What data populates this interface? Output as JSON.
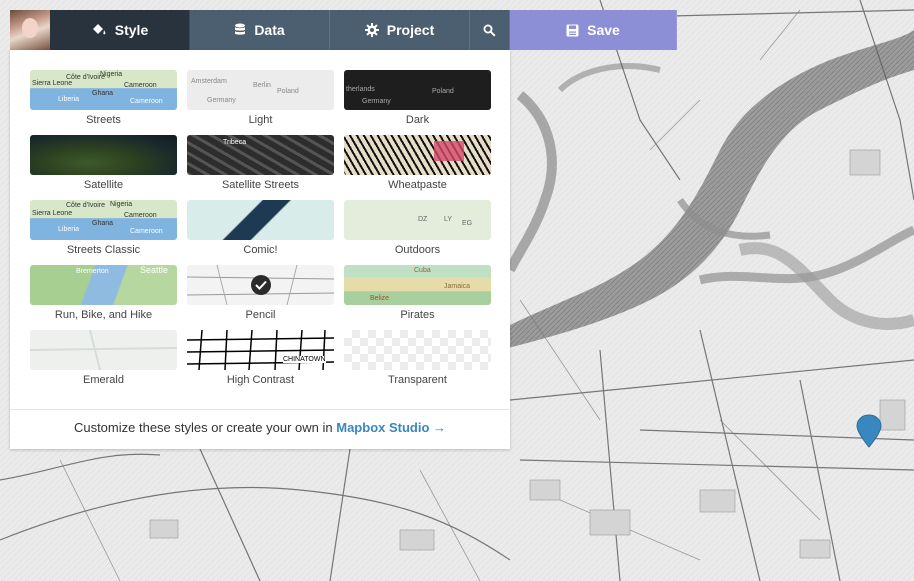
{
  "toolbar": {
    "tabs": [
      {
        "label": "Style",
        "icon": "paint-bucket-icon",
        "active": true
      },
      {
        "label": "Data",
        "icon": "database-icon"
      },
      {
        "label": "Project",
        "icon": "gear-icon"
      },
      {
        "label": "",
        "icon": "search-icon"
      }
    ],
    "save_label": "Save",
    "colors": {
      "active": "#28333d",
      "inactive": "#4c5f70",
      "save": "#8c8ed6"
    }
  },
  "styles": [
    {
      "label": "Streets",
      "thumb_text": [
        "Nigeria",
        "Côte d'Ivoire",
        "Sierra Leone",
        "Ghana",
        "Liberia",
        "Cameroon",
        "Cameroon"
      ]
    },
    {
      "label": "Light",
      "thumb_text": [
        "Amsterdam",
        "Berlin",
        "Germany",
        "Poland"
      ]
    },
    {
      "label": "Dark",
      "thumb_text": [
        "therlands",
        "Poland",
        "Germany"
      ]
    },
    {
      "label": "Satellite"
    },
    {
      "label": "Satellite Streets",
      "thumb_text": [
        "Tribeca"
      ]
    },
    {
      "label": "Wheatpaste"
    },
    {
      "label": "Streets Classic",
      "thumb_text": [
        "Côte d'Ivoire",
        "Nigeria",
        "Sierra Leone",
        "Ghana",
        "Liberia",
        "Cameroon",
        "Cameroon"
      ]
    },
    {
      "label": "Comic!"
    },
    {
      "label": "Outdoors",
      "thumb_text": [
        "DZ",
        "LY",
        "EG"
      ]
    },
    {
      "label": "Run, Bike, and Hike",
      "thumb_text": [
        "Bremerton",
        "Seattle"
      ]
    },
    {
      "label": "Pencil",
      "selected": true
    },
    {
      "label": "Pirates",
      "thumb_text": [
        "Cuba",
        "Jamaica",
        "Belize"
      ]
    },
    {
      "label": "Emerald"
    },
    {
      "label": "High Contrast",
      "thumb_text": [
        "CHINATOWN"
      ]
    },
    {
      "label": "Transparent"
    }
  ],
  "footer": {
    "text": "Customize these styles or create your own in",
    "link": "Mapbox Studio →",
    "link_color": "#3887be"
  },
  "map": {
    "style": "Pencil",
    "marker_color": "#3887be"
  }
}
